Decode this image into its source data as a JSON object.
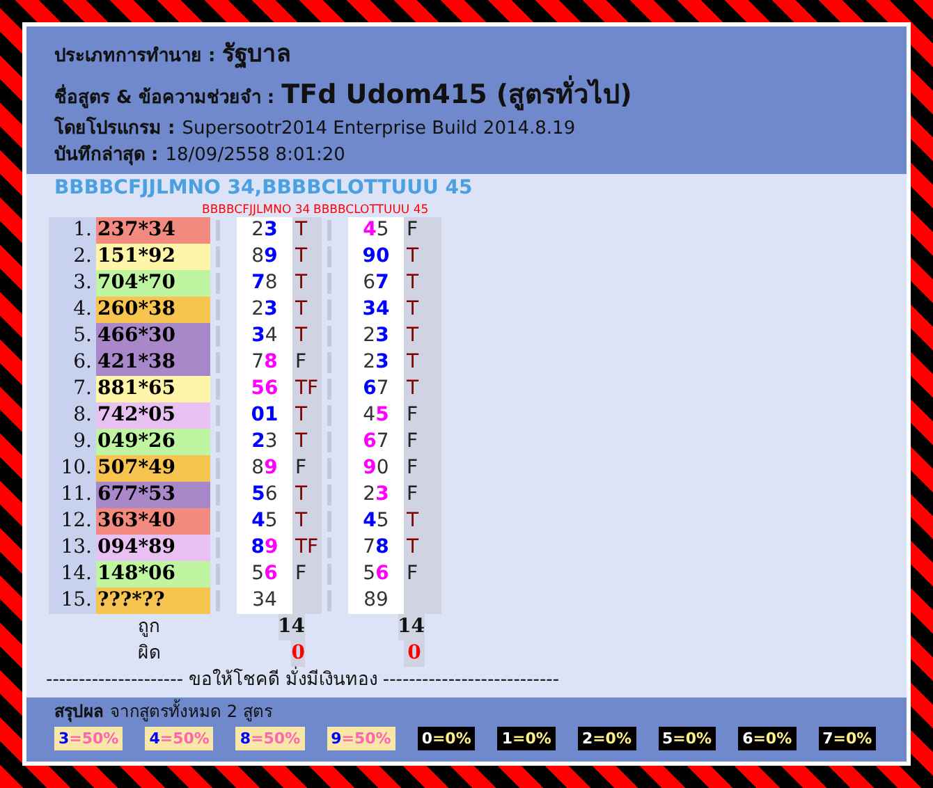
{
  "header": {
    "type_label": "ประเภทการทำนาย :",
    "type_value": "รัฐบาล",
    "formula_label": "ชื่อสูตร & ข้อความช่วยจำ :",
    "formula_value": "TFd Udom415 (สูตรทั่วไป)",
    "program_label": "โดยโปรแกรม :",
    "program_value": "Supersootr2014 Enterprise Build 2014.8.19",
    "saved_label": "บันทึกล่าสุด :",
    "saved_value": "18/09/2558 8:01:20"
  },
  "formulas_title": "BBBBCFJJLMNO 34,BBBBCLOTTUUU 45",
  "columns": [
    "BBBBCFJJLMNO 34",
    "BBBBCLOTTUUU 45"
  ],
  "rows": [
    {
      "index": "1.",
      "number": "237*34",
      "color": "#f28a80",
      "picks": [
        {
          "digits": [
            {
              "d": "2",
              "color": "#333333"
            },
            {
              "d": "3",
              "color": "#0000ff"
            }
          ],
          "result": "T"
        },
        {
          "digits": [
            {
              "d": "4",
              "color": "#ff00ff"
            },
            {
              "d": "5",
              "color": "#333333"
            }
          ],
          "result": "F"
        }
      ]
    },
    {
      "index": "2.",
      "number": "151*92",
      "color": "#fff5a8",
      "picks": [
        {
          "digits": [
            {
              "d": "8",
              "color": "#333333"
            },
            {
              "d": "9",
              "color": "#0000ff"
            }
          ],
          "result": "T"
        },
        {
          "digits": [
            {
              "d": "9",
              "color": "#0000ff"
            },
            {
              "d": "0",
              "color": "#0000ff"
            }
          ],
          "result": "T"
        }
      ]
    },
    {
      "index": "3.",
      "number": "704*70",
      "color": "#bff5a0",
      "picks": [
        {
          "digits": [
            {
              "d": "7",
              "color": "#0000ff"
            },
            {
              "d": "8",
              "color": "#333333"
            }
          ],
          "result": "T"
        },
        {
          "digits": [
            {
              "d": "6",
              "color": "#333333"
            },
            {
              "d": "7",
              "color": "#0000ff"
            }
          ],
          "result": "T"
        }
      ]
    },
    {
      "index": "4.",
      "number": "260*38",
      "color": "#f8c450",
      "picks": [
        {
          "digits": [
            {
              "d": "2",
              "color": "#333333"
            },
            {
              "d": "3",
              "color": "#0000ff"
            }
          ],
          "result": "T"
        },
        {
          "digits": [
            {
              "d": "3",
              "color": "#0000ff"
            },
            {
              "d": "4",
              "color": "#0000ff"
            }
          ],
          "result": "T"
        }
      ]
    },
    {
      "index": "5.",
      "number": "466*30",
      "color": "#a888c8",
      "picks": [
        {
          "digits": [
            {
              "d": "3",
              "color": "#0000ff"
            },
            {
              "d": "4",
              "color": "#333333"
            }
          ],
          "result": "T"
        },
        {
          "digits": [
            {
              "d": "2",
              "color": "#333333"
            },
            {
              "d": "3",
              "color": "#0000ff"
            }
          ],
          "result": "T"
        }
      ]
    },
    {
      "index": "6.",
      "number": "421*38",
      "color": "#a888c8",
      "picks": [
        {
          "digits": [
            {
              "d": "7",
              "color": "#333333"
            },
            {
              "d": "8",
              "color": "#ff00ff"
            }
          ],
          "result": "F"
        },
        {
          "digits": [
            {
              "d": "2",
              "color": "#333333"
            },
            {
              "d": "3",
              "color": "#0000ff"
            }
          ],
          "result": "T"
        }
      ]
    },
    {
      "index": "7.",
      "number": "881*65",
      "color": "#fff5a8",
      "picks": [
        {
          "digits": [
            {
              "d": "5",
              "color": "#ff00ff"
            },
            {
              "d": "6",
              "color": "#ff00ff"
            }
          ],
          "result": "TF"
        },
        {
          "digits": [
            {
              "d": "6",
              "color": "#0000ff"
            },
            {
              "d": "7",
              "color": "#333333"
            }
          ],
          "result": "T"
        }
      ]
    },
    {
      "index": "8.",
      "number": "742*05",
      "color": "#e8c0f2",
      "picks": [
        {
          "digits": [
            {
              "d": "0",
              "color": "#0000ff"
            },
            {
              "d": "1",
              "color": "#0000ff"
            }
          ],
          "result": "T"
        },
        {
          "digits": [
            {
              "d": "4",
              "color": "#333333"
            },
            {
              "d": "5",
              "color": "#ff00ff"
            }
          ],
          "result": "F"
        }
      ]
    },
    {
      "index": "9.",
      "number": "049*26",
      "color": "#bff5a0",
      "picks": [
        {
          "digits": [
            {
              "d": "2",
              "color": "#0000ff"
            },
            {
              "d": "3",
              "color": "#333333"
            }
          ],
          "result": "T"
        },
        {
          "digits": [
            {
              "d": "6",
              "color": "#ff00ff"
            },
            {
              "d": "7",
              "color": "#333333"
            }
          ],
          "result": "F"
        }
      ]
    },
    {
      "index": "10.",
      "number": "507*49",
      "color": "#f8c450",
      "picks": [
        {
          "digits": [
            {
              "d": "8",
              "color": "#333333"
            },
            {
              "d": "9",
              "color": "#ff00ff"
            }
          ],
          "result": "F"
        },
        {
          "digits": [
            {
              "d": "9",
              "color": "#ff00ff"
            },
            {
              "d": "0",
              "color": "#333333"
            }
          ],
          "result": "F"
        }
      ]
    },
    {
      "index": "11.",
      "number": "677*53",
      "color": "#a888c8",
      "picks": [
        {
          "digits": [
            {
              "d": "5",
              "color": "#0000ff"
            },
            {
              "d": "6",
              "color": "#333333"
            }
          ],
          "result": "T"
        },
        {
          "digits": [
            {
              "d": "2",
              "color": "#333333"
            },
            {
              "d": "3",
              "color": "#ff00ff"
            }
          ],
          "result": "F"
        }
      ]
    },
    {
      "index": "12.",
      "number": "363*40",
      "color": "#f28a80",
      "picks": [
        {
          "digits": [
            {
              "d": "4",
              "color": "#0000ff"
            },
            {
              "d": "5",
              "color": "#333333"
            }
          ],
          "result": "T"
        },
        {
          "digits": [
            {
              "d": "4",
              "color": "#0000ff"
            },
            {
              "d": "5",
              "color": "#333333"
            }
          ],
          "result": "T"
        }
      ]
    },
    {
      "index": "13.",
      "number": "094*89",
      "color": "#e8c0f2",
      "picks": [
        {
          "digits": [
            {
              "d": "8",
              "color": "#0000ff"
            },
            {
              "d": "9",
              "color": "#ff00ff"
            }
          ],
          "result": "TF"
        },
        {
          "digits": [
            {
              "d": "7",
              "color": "#333333"
            },
            {
              "d": "8",
              "color": "#0000ff"
            }
          ],
          "result": "T"
        }
      ]
    },
    {
      "index": "14.",
      "number": "148*06",
      "color": "#bff5a0",
      "picks": [
        {
          "digits": [
            {
              "d": "5",
              "color": "#333333"
            },
            {
              "d": "6",
              "color": "#ff00ff"
            }
          ],
          "result": "F"
        },
        {
          "digits": [
            {
              "d": "5",
              "color": "#333333"
            },
            {
              "d": "6",
              "color": "#ff00ff"
            }
          ],
          "result": "F"
        }
      ]
    },
    {
      "index": "15.",
      "number": "???*??",
      "color": "#f8c450",
      "picks": [
        {
          "digits": [
            {
              "d": "3",
              "color": "#333333"
            },
            {
              "d": "4",
              "color": "#333333"
            }
          ]
        },
        {
          "digits": [
            {
              "d": "8",
              "color": "#333333"
            },
            {
              "d": "9",
              "color": "#333333"
            }
          ]
        }
      ]
    }
  ],
  "totals": [
    {
      "label": "ถูก",
      "kind": "right",
      "values": [
        "14",
        "14"
      ]
    },
    {
      "label": "ผิด",
      "kind": "wrong",
      "values": [
        "0",
        "0"
      ]
    }
  ],
  "wish": "--------------------- ขอให้โชคดี มั่งมีเงินทอง ---------------------------",
  "summary": {
    "title": "สรุปผล",
    "subtitle": "จากสูตรทั้งหมด 2 สูตร",
    "chips": [
      {
        "digit": "3",
        "value": "=50%",
        "kind": "hit"
      },
      {
        "digit": "4",
        "value": "=50%",
        "kind": "hit"
      },
      {
        "digit": "8",
        "value": "=50%",
        "kind": "hit"
      },
      {
        "digit": "9",
        "value": "=50%",
        "kind": "hit"
      },
      {
        "digit": "0",
        "value": "=0%",
        "kind": "miss"
      },
      {
        "digit": "1",
        "value": "=0%",
        "kind": "miss"
      },
      {
        "digit": "2",
        "value": "=0%",
        "kind": "miss"
      },
      {
        "digit": "5",
        "value": "=0%",
        "kind": "miss"
      },
      {
        "digit": "6",
        "value": "=0%",
        "kind": "miss"
      },
      {
        "digit": "7",
        "value": "=0%",
        "kind": "miss"
      }
    ]
  }
}
